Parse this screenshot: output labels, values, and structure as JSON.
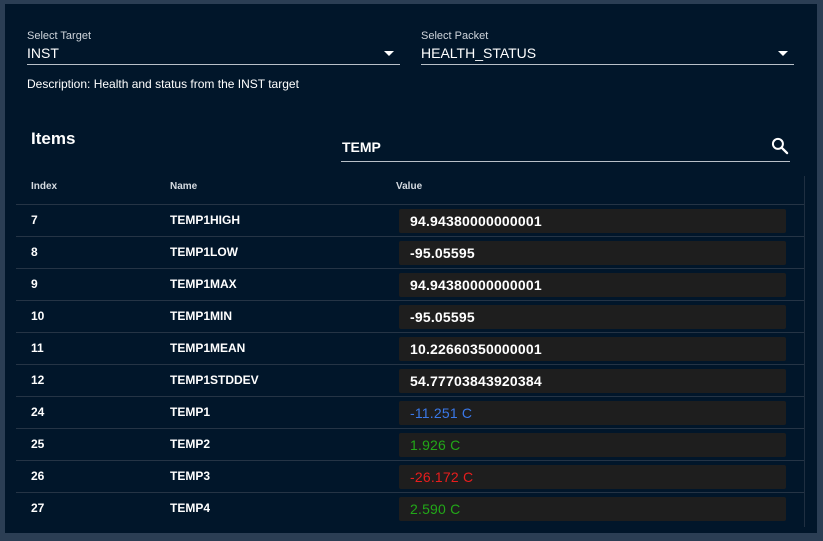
{
  "target_select": {
    "label": "Select Target",
    "value": "INST"
  },
  "packet_select": {
    "label": "Select Packet",
    "value": "HEALTH_STATUS"
  },
  "description": "Description: Health and status from the INST target",
  "items_title": "Items",
  "search": {
    "value": "TEMP",
    "icon": "search-icon"
  },
  "table": {
    "headers": {
      "index": "Index",
      "name": "Name",
      "value": "Value"
    },
    "rows": [
      {
        "index": "7",
        "name": "TEMP1HIGH",
        "value": "94.94380000000001",
        "status": "default"
      },
      {
        "index": "8",
        "name": "TEMP1LOW",
        "value": "-95.05595",
        "status": "default"
      },
      {
        "index": "9",
        "name": "TEMP1MAX",
        "value": "94.94380000000001",
        "status": "default"
      },
      {
        "index": "10",
        "name": "TEMP1MIN",
        "value": "-95.05595",
        "status": "default"
      },
      {
        "index": "11",
        "name": "TEMP1MEAN",
        "value": "10.22660350000001",
        "status": "default"
      },
      {
        "index": "12",
        "name": "TEMP1STDDEV",
        "value": "54.77703843920384",
        "status": "default"
      },
      {
        "index": "24",
        "name": "TEMP1",
        "value": "-11.251 C",
        "status": "blue"
      },
      {
        "index": "25",
        "name": "TEMP2",
        "value": "1.926 C",
        "status": "green"
      },
      {
        "index": "26",
        "name": "TEMP3",
        "value": "-26.172 C",
        "status": "red"
      },
      {
        "index": "27",
        "name": "TEMP4",
        "value": "2.590 C",
        "status": "green"
      }
    ]
  },
  "colors": {
    "background": "#01162a",
    "blue": "#3a78e8",
    "green": "#22a818",
    "red": "#e81d1d"
  }
}
